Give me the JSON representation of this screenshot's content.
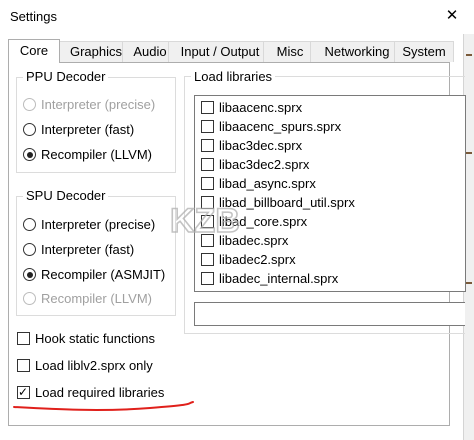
{
  "window": {
    "title": "Settings",
    "close_glyph": "✕"
  },
  "tabs": [
    {
      "label": "Core",
      "active": true
    },
    {
      "label": "Graphics"
    },
    {
      "label": "Audio"
    },
    {
      "label": "Input / Output"
    },
    {
      "label": "Misc"
    },
    {
      "label": "Networking"
    },
    {
      "label": "System"
    }
  ],
  "ppu": {
    "title": "PPU Decoder",
    "options": [
      {
        "label": "Interpreter (precise)",
        "checked": false,
        "disabled": true
      },
      {
        "label": "Interpreter (fast)",
        "checked": false,
        "disabled": false
      },
      {
        "label": "Recompiler (LLVM)",
        "checked": true,
        "disabled": false
      }
    ]
  },
  "spu": {
    "title": "SPU Decoder",
    "options": [
      {
        "label": "Interpreter (precise)",
        "checked": false,
        "disabled": false
      },
      {
        "label": "Interpreter (fast)",
        "checked": false,
        "disabled": false
      },
      {
        "label": "Recompiler (ASMJIT)",
        "checked": true,
        "disabled": false
      },
      {
        "label": "Recompiler (LLVM)",
        "checked": false,
        "disabled": true
      }
    ]
  },
  "checkboxes": [
    {
      "label": "Hook static functions",
      "checked": false
    },
    {
      "label": "Load liblv2.sprx only",
      "checked": false
    },
    {
      "label": "Load required libraries",
      "checked": true
    }
  ],
  "libraries": {
    "title": "Load libraries",
    "items": [
      "libaacenc.sprx",
      "libaacenc_spurs.sprx",
      "libac3dec.sprx",
      "libac3dec2.sprx",
      "libad_async.sprx",
      "libad_billboard_util.sprx",
      "libad_core.sprx",
      "libadec.sprx",
      "libadec2.sprx",
      "libadec_internal.sprx"
    ],
    "filter_value": ""
  },
  "watermark": {
    "text": "KZB"
  },
  "colors": {
    "annotation": "#e0201b",
    "border": "#adadad"
  }
}
